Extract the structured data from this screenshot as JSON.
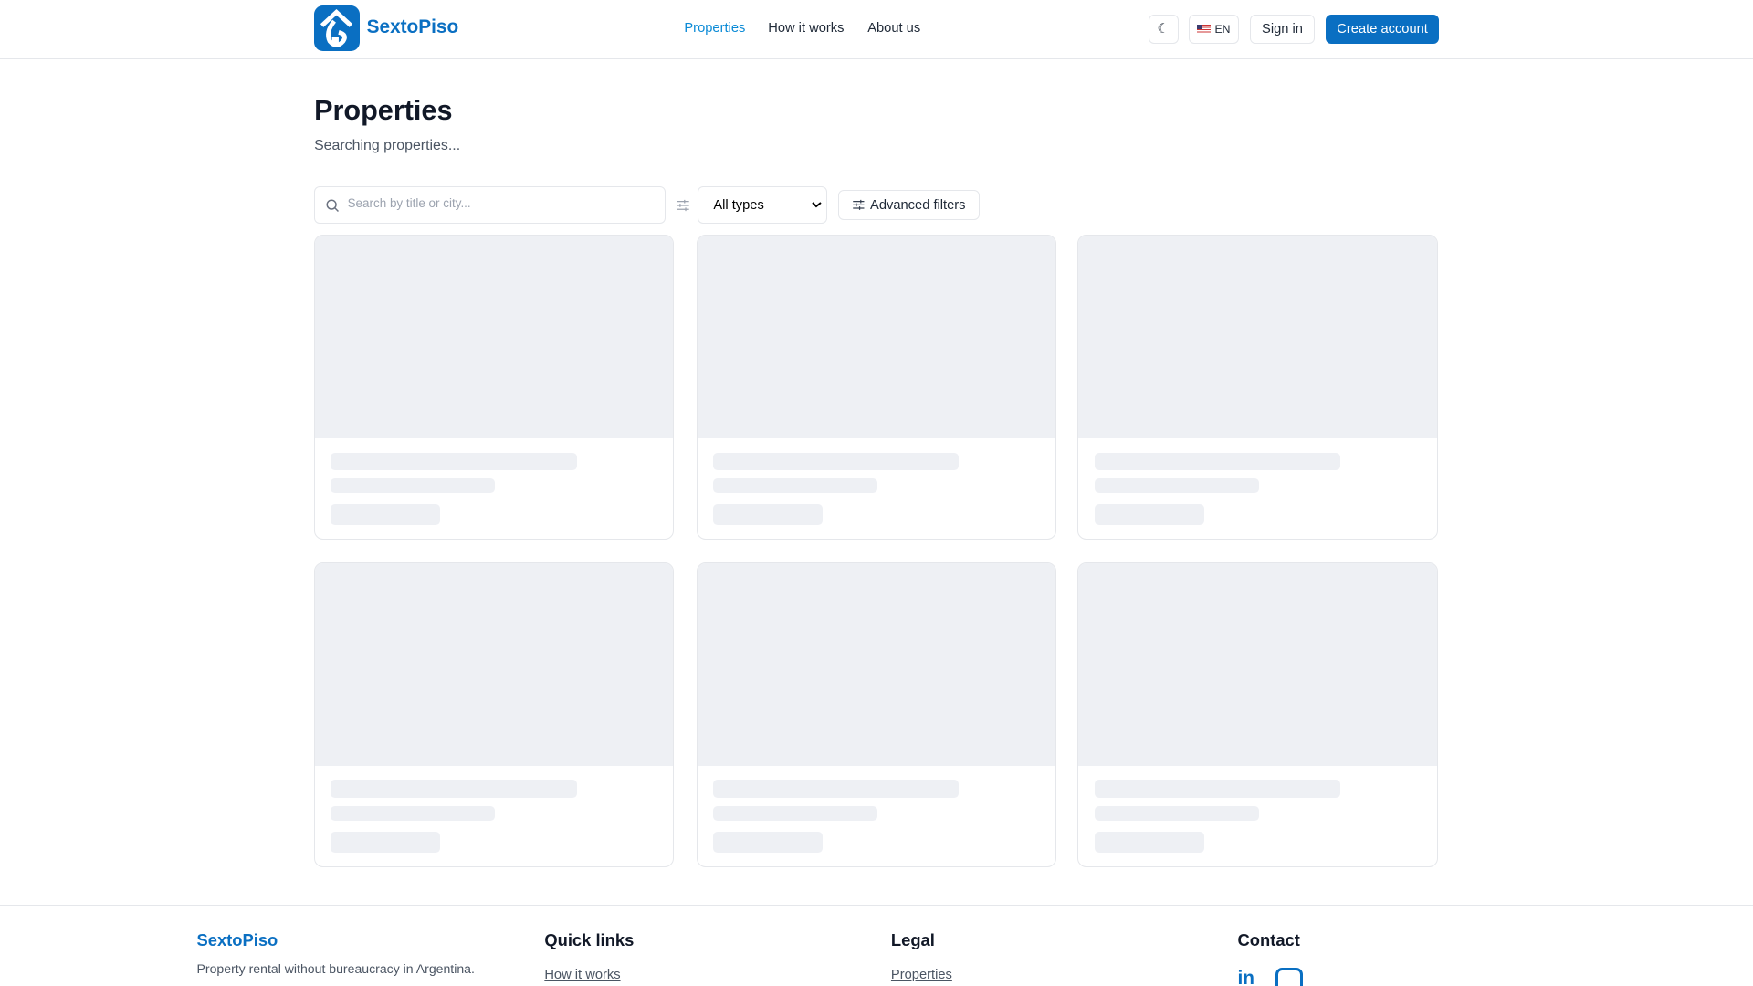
{
  "brand": {
    "name": "SextoPiso",
    "color": "#0a6fc2"
  },
  "nav": {
    "items": [
      "Properties",
      "How it works",
      "About us"
    ],
    "active": "Properties"
  },
  "header": {
    "language": "EN",
    "sign_in": "Sign in",
    "create_account": "Create account"
  },
  "page": {
    "title": "Properties",
    "subtitle": "Searching properties...",
    "search_placeholder": "Search by title or city...",
    "type_select": "All types",
    "advanced_filters": "Advanced filters"
  },
  "cards_loading": 6,
  "footer": {
    "brand": "SextoPiso",
    "tagline": "Property rental without bureaucracy in Argentina.",
    "quick_links": {
      "title": "Quick links",
      "items": [
        "How it works"
      ]
    },
    "legal": {
      "title": "Legal",
      "items": [
        "Properties"
      ]
    },
    "contact": {
      "title": "Contact",
      "icons": [
        "linkedin-icon",
        "instagram-icon"
      ]
    }
  }
}
